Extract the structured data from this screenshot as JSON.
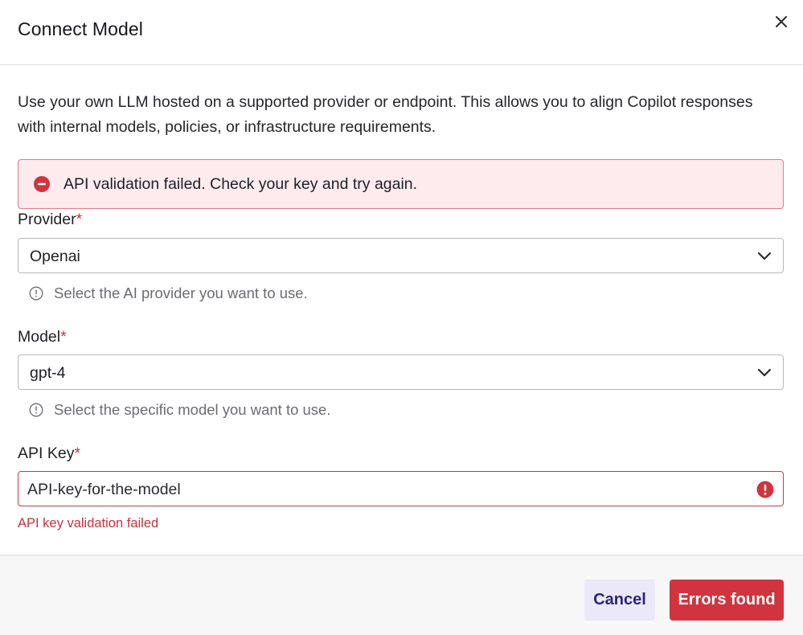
{
  "dialog": {
    "title": "Connect Model",
    "close_icon": "close-icon"
  },
  "description": "Use your own LLM hosted on a supported provider or endpoint. This allows you to align Copilot responses with internal models, policies, or infrastructure requirements.",
  "alert": {
    "icon": "minus-circle-icon",
    "message": "API validation failed. Check your key and try again.",
    "background_color": "#fdebee",
    "border_color": "#e27c86"
  },
  "provider": {
    "label": "Provider",
    "required_mark": "*",
    "value": "Openai",
    "hint": "Select the AI provider you want to use."
  },
  "model": {
    "label": "Model",
    "required_mark": "*",
    "value": "gpt-4",
    "hint": "Select the specific model you want to use."
  },
  "api_key": {
    "label": "API Key",
    "required_mark": "*",
    "value": "API-key-for-the-model",
    "error_icon": "exclamation-circle-icon",
    "error": "API key validation failed"
  },
  "footer": {
    "cancel_label": "Cancel",
    "submit_label": "Errors found"
  },
  "colors": {
    "error": "#d1343e",
    "cancel_bg": "#ebe8f7",
    "cancel_text": "#2e2677"
  }
}
